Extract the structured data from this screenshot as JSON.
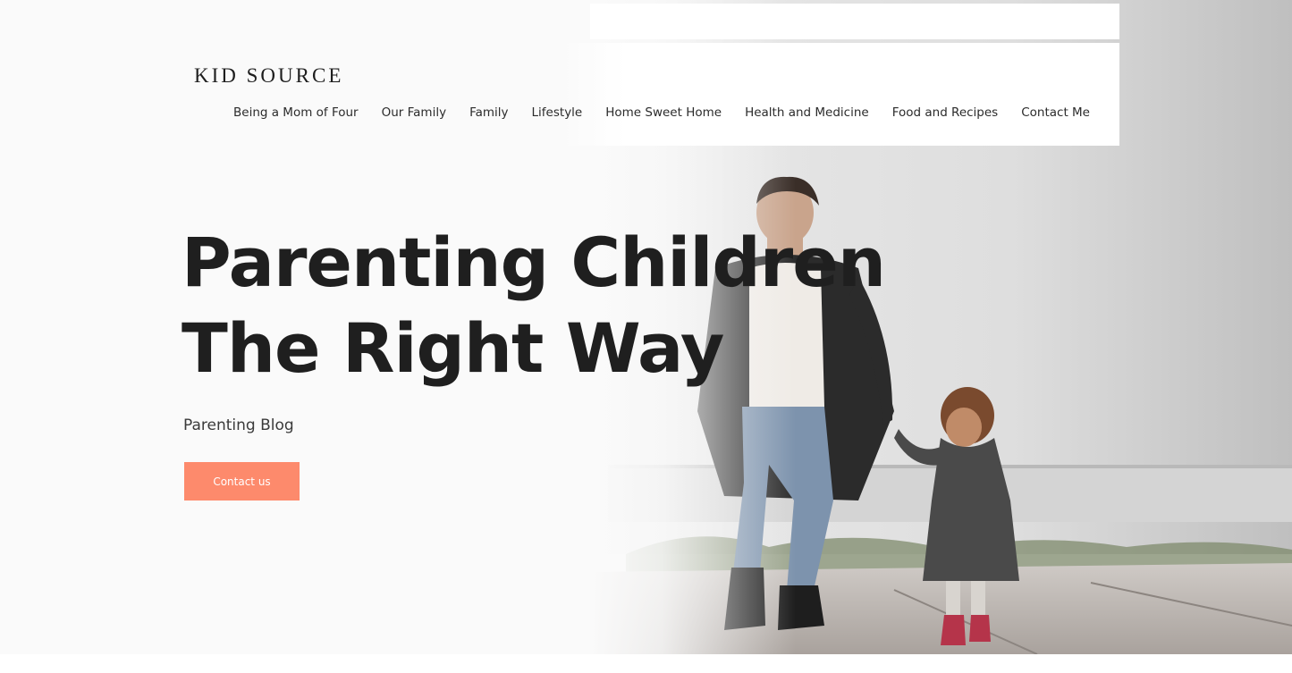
{
  "brand": {
    "logo_text": "KID SOURCE"
  },
  "nav": {
    "items": [
      "Being a Mom of Four",
      "Our Family",
      "Family",
      "Lifestyle",
      "Home Sweet Home",
      "Health and Medicine",
      "Food and Recipes",
      "Contact Me"
    ]
  },
  "hero": {
    "title_line_1": "Parenting Children",
    "title_line_2": "The Right Way",
    "subtitle": "Parenting Blog",
    "cta_label": "Contact us",
    "image_subject": "mother-and-toddler-walking-photo"
  },
  "colors": {
    "accent": "#fd8a6c",
    "text": "#1f1f1f",
    "background": "#fafafa"
  }
}
